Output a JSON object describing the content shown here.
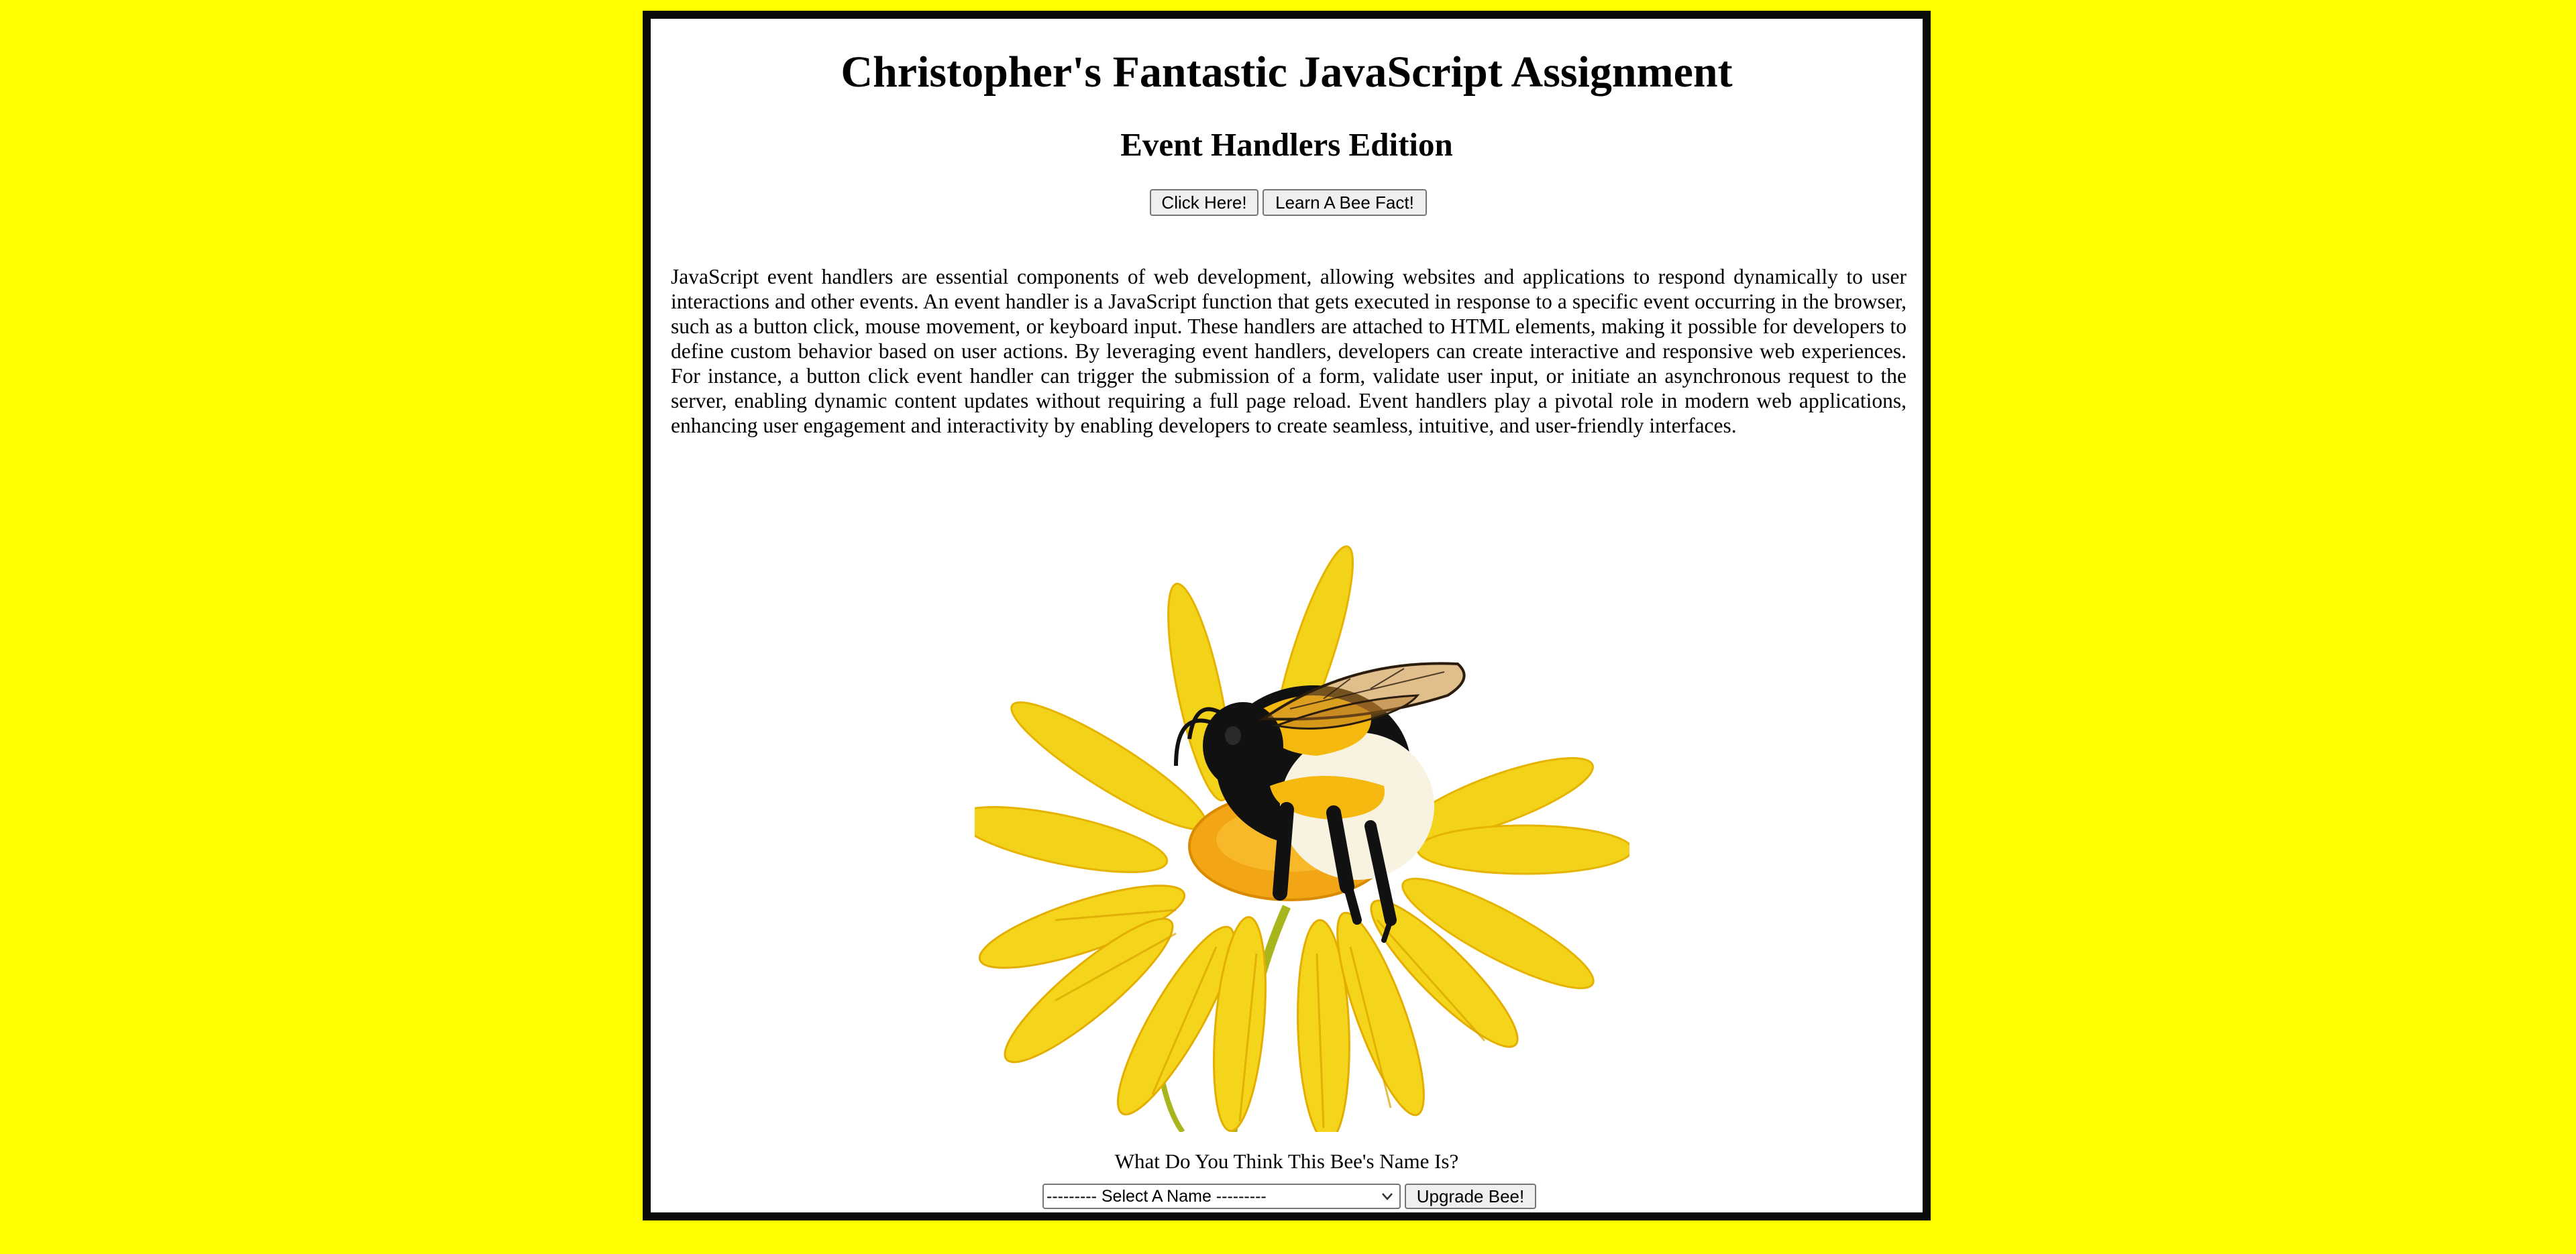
{
  "header": {
    "title": "Christopher's Fantastic JavaScript Assignment",
    "subtitle": "Event Handlers Edition"
  },
  "buttons": {
    "click_here": "Click Here!",
    "bee_fact": "Learn A Bee Fact!",
    "upgrade": "Upgrade Bee!"
  },
  "content": {
    "paragraph": "JavaScript event handlers are essential components of web development, allowing websites and applications to respond dynamically to user interactions and other events. An event handler is a JavaScript function that gets executed in response to a specific event occurring in the browser, such as a button click, mouse movement, or keyboard input. These handlers are attached to HTML elements, making it possible for developers to define custom behavior based on user actions. By leveraging event handlers, developers can create interactive and responsive web experiences. For instance, a button click event handler can trigger the submission of a form, validate user input, or initiate an asynchronous request to the server, enabling dynamic content updates without requiring a full page reload. Event handlers play a pivotal role in modern web applications, enhancing user engagement and interactivity by enabling developers to create seamless, intuitive, and user-friendly interfaces."
  },
  "name_picker": {
    "question": "What Do You Think This Bee's Name Is?",
    "selected": "--------- Select A Name ---------"
  },
  "image": {
    "subject": "bumblebee-on-yellow-daisy"
  },
  "colors": {
    "page_background": "#ffff00",
    "panel_background": "#ffffff",
    "panel_border": "#0a0a0a",
    "petal": "#f3d21a",
    "bee_yellow": "#f5b80f"
  }
}
